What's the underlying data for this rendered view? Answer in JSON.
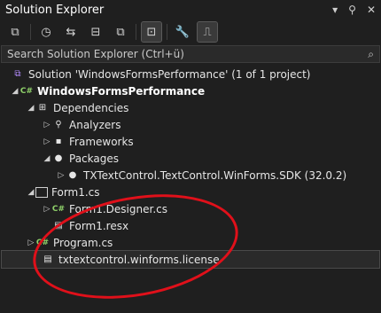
{
  "window": {
    "title": "Solution Explorer",
    "controls": [
      "▾",
      "📌",
      "✕"
    ]
  },
  "search": {
    "placeholder": "Search Solution Explorer (Ctrl+ü)",
    "icon": "search-icon"
  },
  "tree": {
    "solution_label": "Solution 'WindowsFormsPerformance' (1 of 1 project)",
    "project_label": "WindowsFormsPerformance",
    "dependencies_label": "Dependencies",
    "analyzers_label": "Analyzers",
    "frameworks_label": "Frameworks",
    "packages_label": "Packages",
    "package_label": "TXTextControl.TextControl.WinForms.SDK (32.0.2)",
    "form1_label": "Form1.cs",
    "form1_designer_label": "Form1.Designer.cs",
    "form1_resx_label": "Form1.resx",
    "program_label": "Program.cs",
    "license_label": "txtextcontrol.winforms.license"
  },
  "annotation": {
    "color": "#e0101a"
  }
}
